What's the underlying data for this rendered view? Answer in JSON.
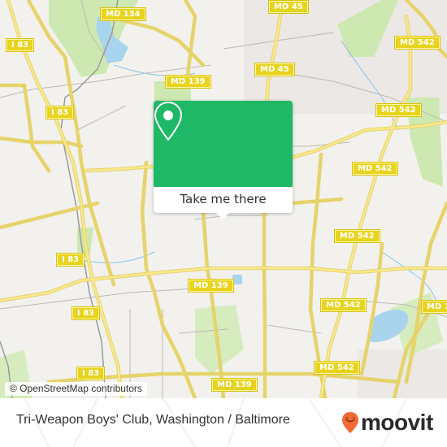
{
  "map": {
    "attribution": "© OpenStreetMap contributors",
    "road_labels": [
      {
        "id": "md134",
        "label": "MD 134"
      },
      {
        "id": "md45-top",
        "label": "MD 45"
      },
      {
        "id": "md45",
        "label": "MD 45"
      },
      {
        "id": "md542-ne",
        "label": "MD 542"
      },
      {
        "id": "i83-nw",
        "label": "I 83"
      },
      {
        "id": "md139-n",
        "label": "MD 139"
      },
      {
        "id": "md542-e1",
        "label": "MD 542"
      },
      {
        "id": "i83-w1",
        "label": "I 83"
      },
      {
        "id": "md542-e2",
        "label": "MD 542"
      },
      {
        "id": "i83-w2",
        "label": "I 83"
      },
      {
        "id": "md542-c",
        "label": "MD 542"
      },
      {
        "id": "md139-c",
        "label": "MD 139"
      },
      {
        "id": "md542-c2",
        "label": "MD 542"
      },
      {
        "id": "i83-w3",
        "label": "I 83"
      },
      {
        "id": "md1-e",
        "label": "MD 1"
      },
      {
        "id": "md542-s",
        "label": "MD 542"
      },
      {
        "id": "i83-s",
        "label": "I 83"
      },
      {
        "id": "md139-s",
        "label": "MD 139"
      }
    ],
    "colors": {
      "background": "#f2f1ee",
      "park": "#cde8b0",
      "water": "#a9d4ee",
      "major_road": "#f8e26b",
      "minor_road": "#bdb9b3"
    }
  },
  "popup": {
    "icon": "map-pin-icon",
    "button_label": "Take me there",
    "accent_color": "#1eb866"
  },
  "footer": {
    "title": "Tri-Weapon Boys' Club, Washington / Baltimore",
    "brand": "moovit",
    "brand_icon": "moovit-smiley-pin-icon",
    "brand_color": "#f26a36"
  }
}
